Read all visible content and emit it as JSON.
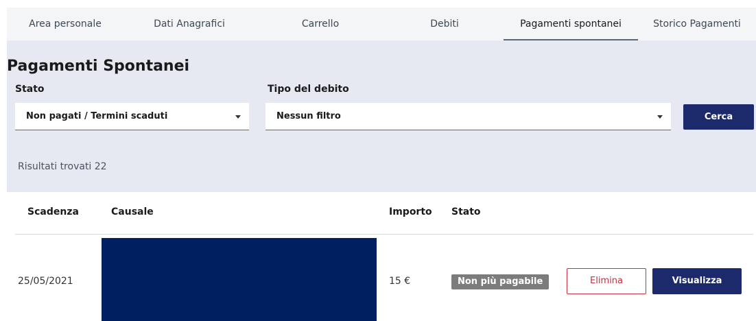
{
  "tabs": [
    {
      "label": "Area personale",
      "active": false
    },
    {
      "label": "Dati Anagrafici",
      "active": false
    },
    {
      "label": "Carrello",
      "active": false
    },
    {
      "label": "Debiti",
      "active": false
    },
    {
      "label": "Pagamenti spontanei",
      "active": true
    },
    {
      "label": "Storico Pagamenti",
      "active": false
    }
  ],
  "page": {
    "title": "Pagamenti Spontanei"
  },
  "filters": {
    "stato_label": "Stato",
    "stato_value": "Non pagati / Termini scaduti",
    "tipo_label": "Tipo del debito",
    "tipo_value": "Nessun filtro",
    "search_label": "Cerca"
  },
  "results": {
    "text": "Risultati trovati 22"
  },
  "table": {
    "headers": {
      "scadenza": "Scadenza",
      "causale": "Causale",
      "importo": "Importo",
      "stato": "Stato"
    },
    "rows": [
      {
        "scadenza": "25/05/2021",
        "causale": "",
        "importo": "15 €",
        "stato": "Non più pagabile",
        "delete_label": "Elimina",
        "view_label": "Visualizza"
      }
    ]
  },
  "colors": {
    "primary": "#1c2a6b",
    "danger": "#c4303d",
    "panel": "#e6e9f2",
    "badge": "#7c7c7c"
  }
}
